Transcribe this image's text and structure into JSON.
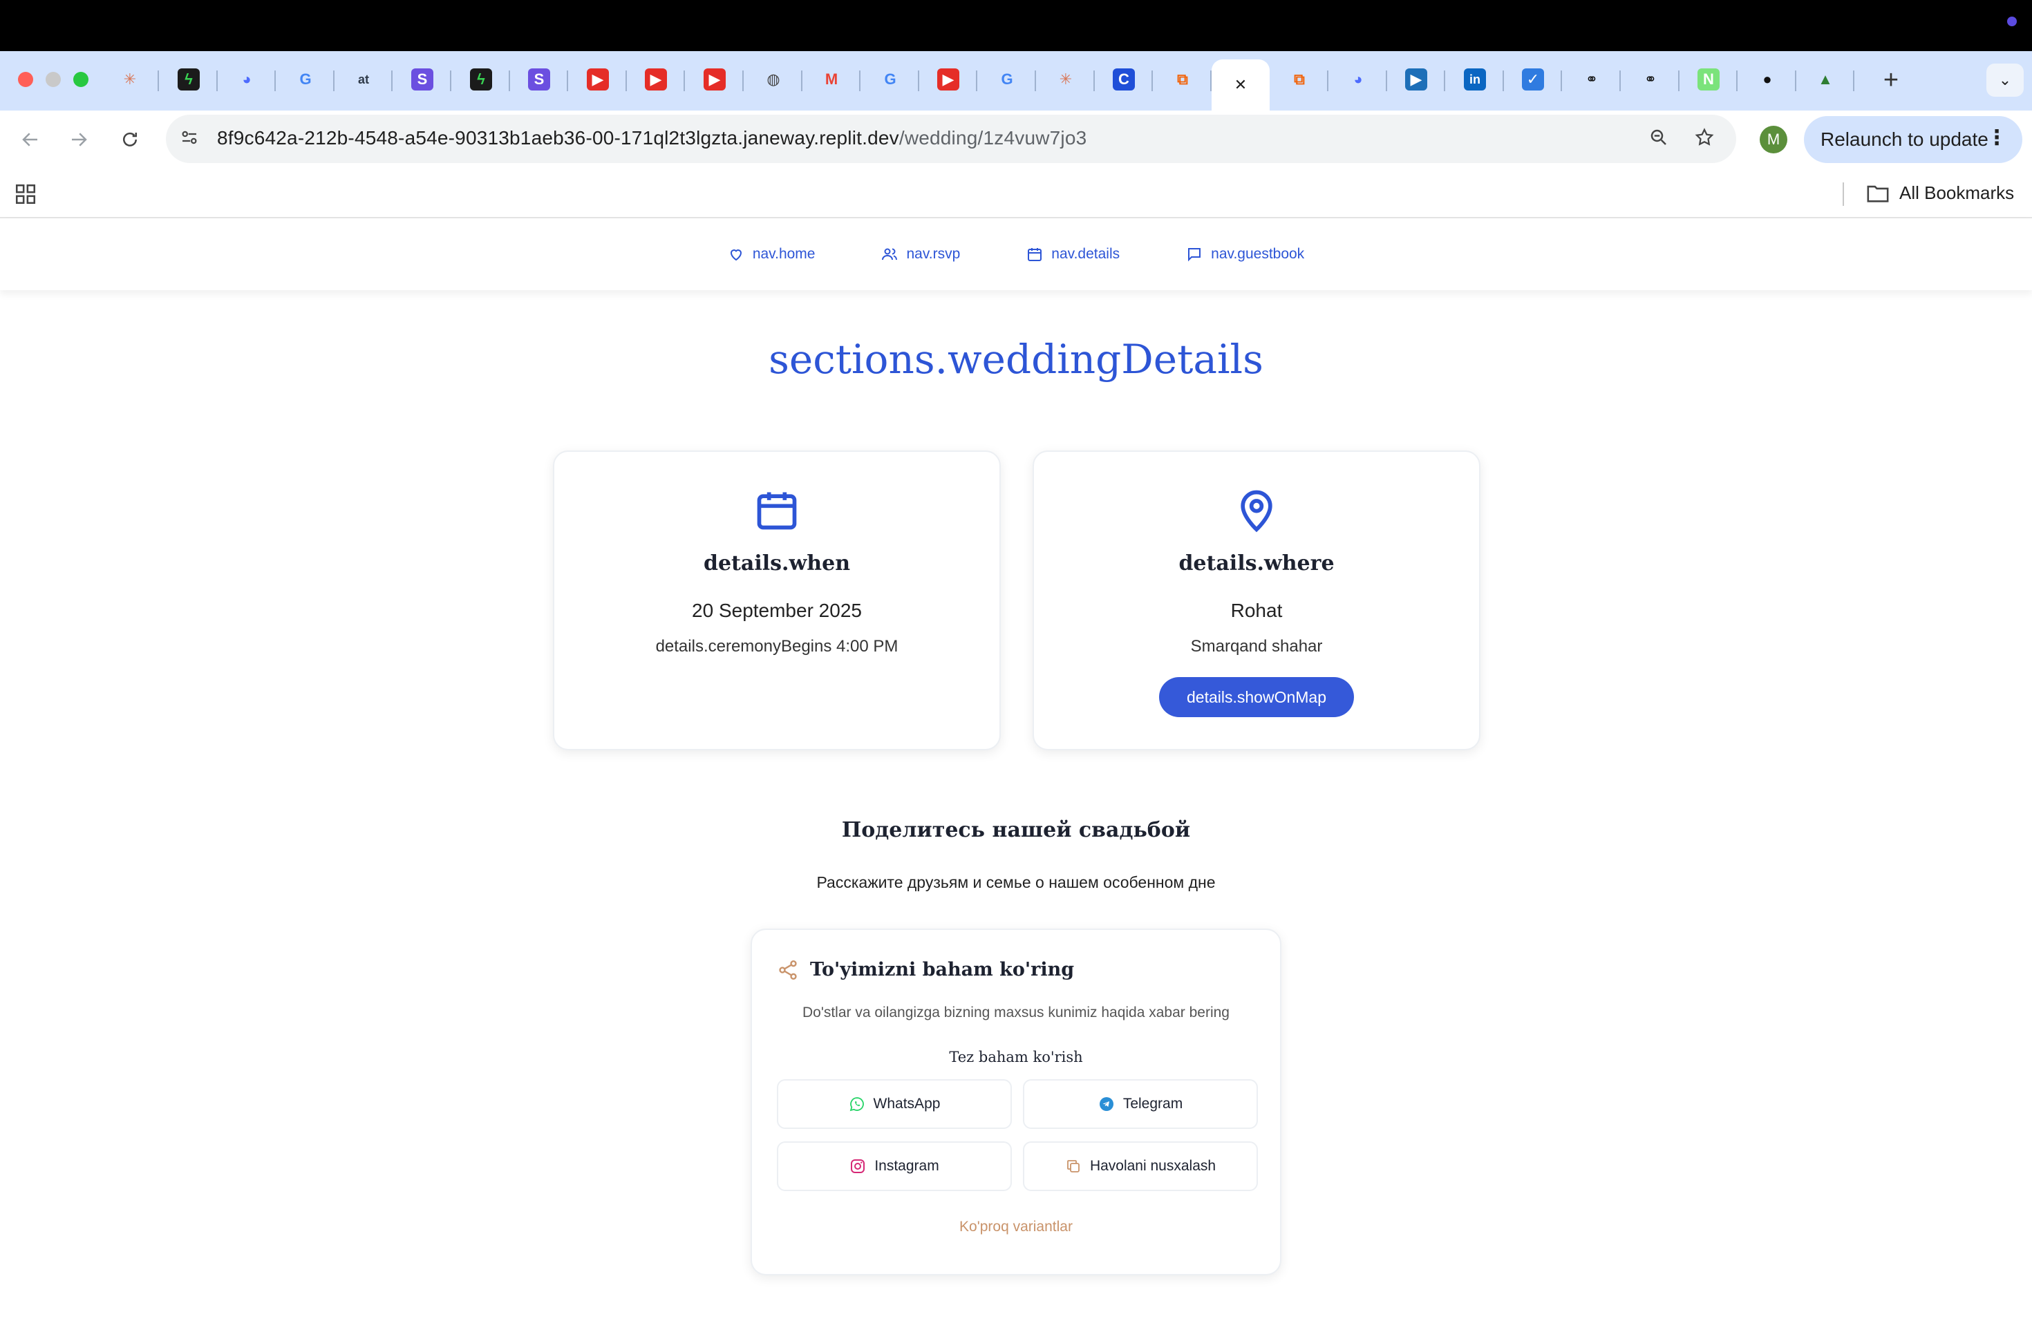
{
  "browser": {
    "url_host": "8f9c642a-212b-4548-a54e-90313b1aeb36-00-171ql2t3lgzta.janeway.replit.dev",
    "url_path": "/wedding/1z4vuw7jo3",
    "avatar_letter": "M",
    "relaunch_label": "Relaunch to update",
    "all_bookmarks_label": "All Bookmarks",
    "tabs": [
      {
        "icon": "claude-icon",
        "glyph": "✳",
        "bg": "transparent",
        "color": "#d97757"
      },
      {
        "icon": "bolt-icon",
        "glyph": "ϟ",
        "bg": "#1b1b1b",
        "color": "#39d353"
      },
      {
        "icon": "deepseek-icon",
        "glyph": "◕",
        "bg": "transparent",
        "color": "#4d6bfe"
      },
      {
        "icon": "google-icon",
        "glyph": "G",
        "bg": "transparent",
        "color": "#4285f4"
      },
      {
        "icon": "at-icon",
        "glyph": "at",
        "bg": "transparent",
        "color": "#2f3b4a"
      },
      {
        "icon": "s-icon",
        "glyph": "S",
        "bg": "#6b4fe0",
        "color": "#ffffff"
      },
      {
        "icon": "bolt-icon",
        "glyph": "ϟ",
        "bg": "#1b1b1b",
        "color": "#39d353"
      },
      {
        "icon": "s-icon",
        "glyph": "S",
        "bg": "#6b4fe0",
        "color": "#ffffff"
      },
      {
        "icon": "youtube-icon",
        "glyph": "▶",
        "bg": "#e52d27",
        "color": "#ffffff"
      },
      {
        "icon": "youtube-icon",
        "glyph": "▶",
        "bg": "#e52d27",
        "color": "#ffffff"
      },
      {
        "icon": "youtube-icon",
        "glyph": "▶",
        "bg": "#e52d27",
        "color": "#ffffff"
      },
      {
        "icon": "globe-icon",
        "glyph": "◍",
        "bg": "transparent",
        "color": "#444444"
      },
      {
        "icon": "gmail-icon",
        "glyph": "M",
        "bg": "transparent",
        "color": "#ea4335"
      },
      {
        "icon": "google-icon",
        "glyph": "G",
        "bg": "transparent",
        "color": "#4285f4"
      },
      {
        "icon": "youtube-icon",
        "glyph": "▶",
        "bg": "#e52d27",
        "color": "#ffffff"
      },
      {
        "icon": "google-icon",
        "glyph": "G",
        "bg": "transparent",
        "color": "#4285f4"
      },
      {
        "icon": "claude-icon",
        "glyph": "✳",
        "bg": "transparent",
        "color": "#d97757"
      },
      {
        "icon": "c-icon",
        "glyph": "C",
        "bg": "#1f4fd8",
        "color": "#ffffff"
      },
      {
        "icon": "replit-icon",
        "glyph": "⧉",
        "bg": "transparent",
        "color": "#f26207"
      },
      {
        "icon": "close-icon",
        "glyph": "✕",
        "bg": "transparent",
        "color": "#1f1f1f"
      },
      {
        "icon": "replit-icon",
        "glyph": "⧉",
        "bg": "transparent",
        "color": "#f26207"
      },
      {
        "icon": "deepseek-icon",
        "glyph": "◕",
        "bg": "transparent",
        "color": "#4d6bfe"
      },
      {
        "icon": "video-icon",
        "glyph": "▶",
        "bg": "#1d6fb8",
        "color": "#ffffff"
      },
      {
        "icon": "linkedin-icon",
        "glyph": "in",
        "bg": "#0a66c2",
        "color": "#ffffff"
      },
      {
        "icon": "tasks-icon",
        "glyph": "✓",
        "bg": "#2f7be0",
        "color": "#ffffff"
      },
      {
        "icon": "link-icon",
        "glyph": "⚭",
        "bg": "transparent",
        "color": "#111111"
      },
      {
        "icon": "link-icon",
        "glyph": "⚭",
        "bg": "transparent",
        "color": "#111111"
      },
      {
        "icon": "n-icon",
        "glyph": "N",
        "bg": "#7be37b",
        "color": "#ffffff"
      },
      {
        "icon": "github-icon",
        "glyph": "●",
        "bg": "transparent",
        "color": "#111111"
      },
      {
        "icon": "book-icon",
        "glyph": "▲",
        "bg": "transparent",
        "color": "#2e7d32"
      }
    ]
  },
  "nav": {
    "home": "nav.home",
    "rsvp": "nav.rsvp",
    "details": "nav.details",
    "guestbook": "nav.guestbook"
  },
  "section_title": "sections.weddingDetails",
  "when_card": {
    "heading": "details.when",
    "date": "20 September 2025",
    "time": "details.ceremonyBegins 4:00 PM"
  },
  "where_card": {
    "heading": "details.where",
    "venue": "Rohat",
    "city": "Smarqand shahar",
    "map_button": "details.showOnMap"
  },
  "share_section": {
    "heading": "Поделитесь нашей свадьбой",
    "description": "Расскажите друзьям и семье о нашем особенном дне"
  },
  "share_card": {
    "title": "To'yimizni baham ko'ring",
    "description": "Do'stlar va oilangizga bizning maxsus kunimiz haqida xabar bering",
    "quick_label": "Tez baham ko'rish",
    "whatsapp": "WhatsApp",
    "telegram": "Telegram",
    "instagram": "Instagram",
    "copy_link": "Havolani nusxalash",
    "more_options": "Ko'proq variantlar"
  },
  "colors": {
    "accent": "#2d55d6",
    "button": "#3559d9",
    "whatsapp": "#25d366",
    "telegram": "#2a8fd6",
    "instagram": "#d62976",
    "copy": "#c9936a"
  }
}
